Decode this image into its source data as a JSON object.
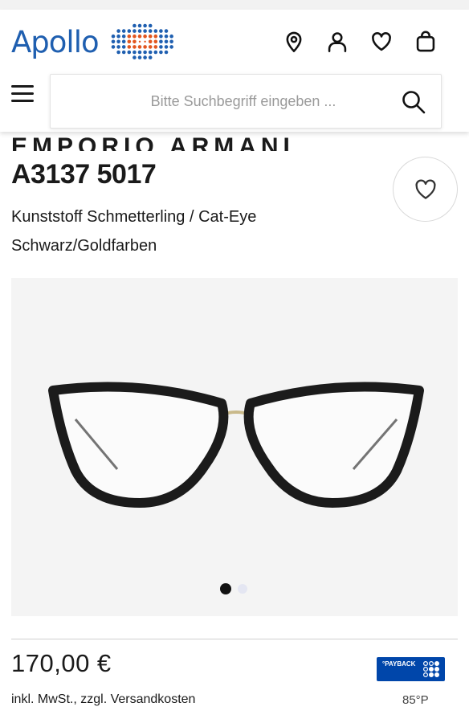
{
  "header": {
    "logo_text": "Apollo",
    "icons": [
      "location-pin-icon",
      "user-icon",
      "heart-icon",
      "shopping-bag-icon"
    ],
    "brand_color": "#1f5fb0",
    "accent_color": "#e2561f"
  },
  "search": {
    "placeholder": "Bitte Suchbegriff eingeben ...",
    "value": ""
  },
  "product": {
    "title": "A3137 5017",
    "material_shape": "Kunststoff Schmetterling / Cat-Eye",
    "color": "Schwarz/Goldfarben",
    "gallery_slide_count": 2,
    "gallery_active_slide": 1
  },
  "pricing": {
    "price": "170,00 €",
    "tax_note": "inkl. MwSt., zzgl. Versandkosten",
    "payback_label": "°PAYBACK",
    "payback_points": "85°P",
    "payback_color": "#0046aa"
  }
}
